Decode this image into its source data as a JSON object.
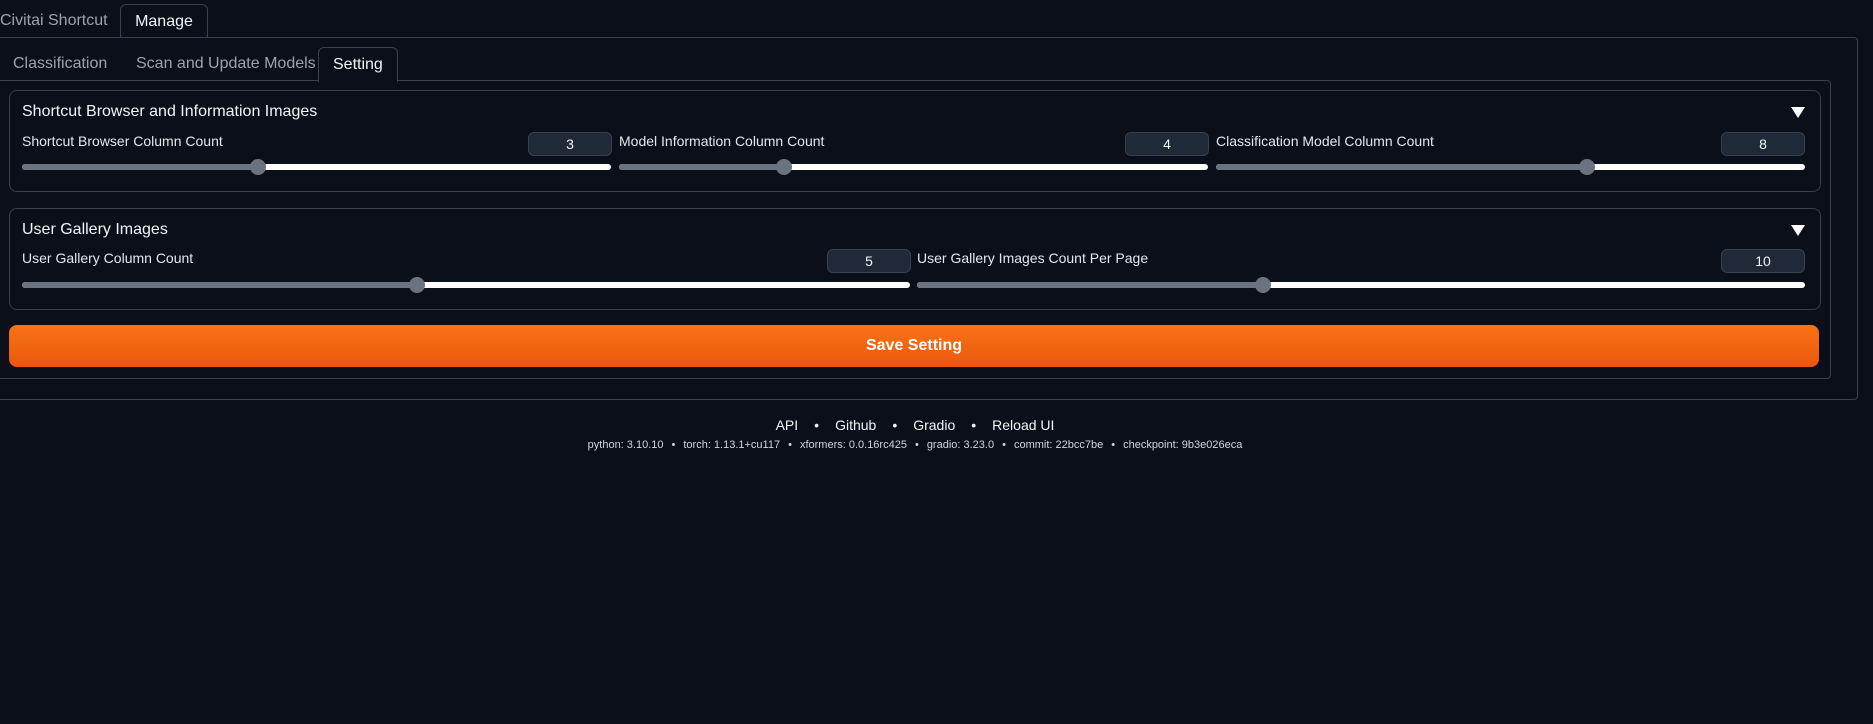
{
  "top_tabs": [
    {
      "label": "Civitai Shortcut",
      "active": false
    },
    {
      "label": "Manage",
      "active": true
    }
  ],
  "sub_tabs": [
    {
      "label": "Classification",
      "active": false
    },
    {
      "label": "Scan and Update Models",
      "active": false
    },
    {
      "label": "Setting",
      "active": true
    }
  ],
  "panel_browser": {
    "title": "Shortcut Browser and Information Images",
    "sliders": [
      {
        "label": "Shortcut Browser Column Count",
        "value": "3",
        "fraction": 0.4
      },
      {
        "label": "Model Information Column Count",
        "value": "4",
        "fraction": 0.28
      },
      {
        "label": "Classification Model Column Count",
        "value": "8",
        "fraction": 0.63
      }
    ]
  },
  "panel_gallery": {
    "title": "User Gallery Images",
    "sliders": [
      {
        "label": "User Gallery Column Count",
        "value": "5",
        "fraction": 0.445
      },
      {
        "label": "User Gallery Images Count Per Page",
        "value": "10",
        "fraction": 0.39
      }
    ]
  },
  "save_button": {
    "label": "Save Setting"
  },
  "footer": {
    "links": [
      "API",
      "Github",
      "Gradio",
      "Reload UI"
    ],
    "separator": "•",
    "versions": [
      "python: 3.10.10",
      "torch: 1.13.1+cu117",
      "xformers: 0.0.16rc425",
      "gradio: 3.23.0",
      "commit: 22bcc7be",
      "checkpoint: 9b3e026eca"
    ]
  },
  "colors": {
    "background": "#0b0f19",
    "border": "#374151",
    "accent": "#f97316",
    "slider_fill": "#6b7280"
  },
  "icons": {
    "panel_toggle": "triangle-down-icon"
  }
}
